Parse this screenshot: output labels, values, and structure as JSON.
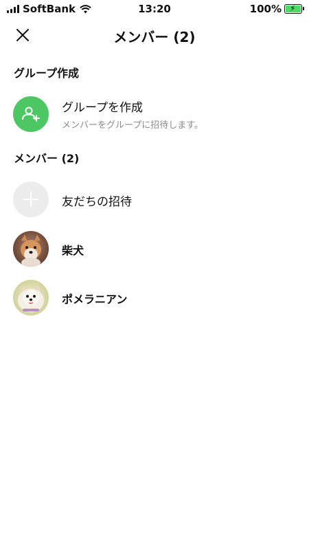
{
  "status_bar": {
    "carrier": "SoftBank",
    "time": "13:20",
    "battery": "100%",
    "battery_level": 1.0,
    "battery_color": "#4cd964"
  },
  "header": {
    "title": "メンバー (2)",
    "close_icon": "close-icon"
  },
  "group_section": {
    "label": "グループ作成",
    "create": {
      "icon": "add-group-icon",
      "title": "グループを作成",
      "subtitle": "メンバーをグループに招待します。",
      "color": "#4cc764"
    }
  },
  "member_section": {
    "label": "メンバー (2)",
    "invite": {
      "icon": "plus-icon",
      "label": "友だちの招待"
    },
    "members": [
      {
        "name": "柴犬",
        "avatar": "shiba-inu-photo"
      },
      {
        "name": "ポメラニアン",
        "avatar": "pomeranian-photo"
      }
    ]
  }
}
